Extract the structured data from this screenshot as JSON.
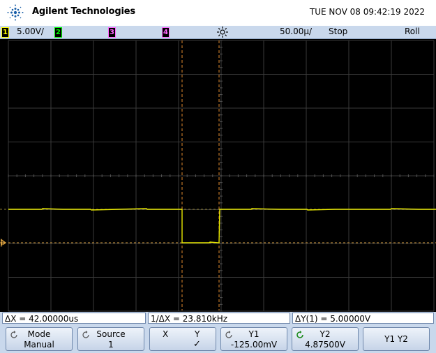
{
  "header": {
    "brand": "Agilent Technologies",
    "datetime": "TUE NOV 08 09:42:19 2022",
    "logo_icon": "agilent-spark-icon"
  },
  "channel_bar": {
    "ch1": {
      "label": "1",
      "scale": "5.00V/",
      "color": "#ffff00"
    },
    "ch2": {
      "label": "2",
      "color": "#00ff00"
    },
    "ch3": {
      "label": "3",
      "color": "#ff66ff"
    },
    "ch4": {
      "label": "4",
      "color": "#ff66ff"
    },
    "trigger_icon": "trigger-sun-icon",
    "timebase": "50.00µ/",
    "run_state": "Stop",
    "trigger_mode": "Roll"
  },
  "screen": {
    "background": "#000000",
    "grid_color": "#3a3a3a",
    "trace_color": "#ffff00",
    "cursor_color": "#ff9933",
    "ground_marker": "1"
  },
  "readouts": {
    "delta_x": "ΔX = 42.00000us",
    "inv_delta_x": "1/ΔX = 23.810kHz",
    "delta_y": "ΔY(1) = 5.00000V"
  },
  "softkeys": {
    "mode": {
      "label": "Mode",
      "value": "Manual"
    },
    "source": {
      "label": "Source",
      "value": "1"
    },
    "xy": {
      "x_label": "X",
      "y_label": "Y",
      "check": "✓"
    },
    "y1": {
      "label": "Y1",
      "value": "-125.00mV"
    },
    "y2": {
      "label": "Y2",
      "value": "4.87500V"
    },
    "y1y2": {
      "label": "Y1 Y2"
    }
  }
}
